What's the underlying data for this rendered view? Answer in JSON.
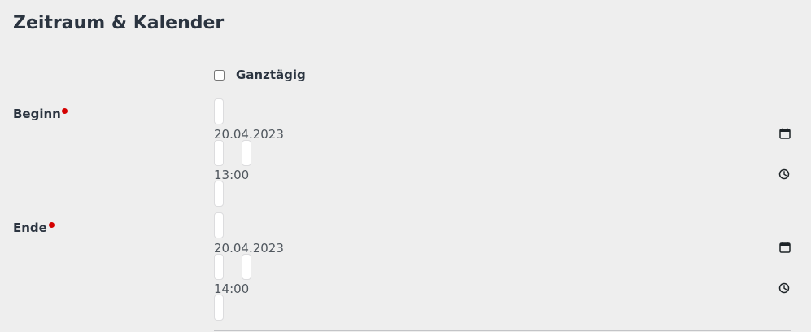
{
  "section": {
    "title": "Zeitraum & Kalender"
  },
  "allday": {
    "label": "Ganztägig",
    "checked": false
  },
  "start": {
    "label": "Beginn",
    "date": "20.04.2023",
    "time": "13:00",
    "date_icon": "calendar-icon",
    "time_icon": "clock-icon"
  },
  "end": {
    "label": "Ende",
    "date": "20.04.2023",
    "time": "14:00",
    "date_icon": "calendar-icon",
    "time_icon": "clock-icon"
  },
  "colors": {
    "required": "#d40000",
    "background": "#eeeeee"
  }
}
